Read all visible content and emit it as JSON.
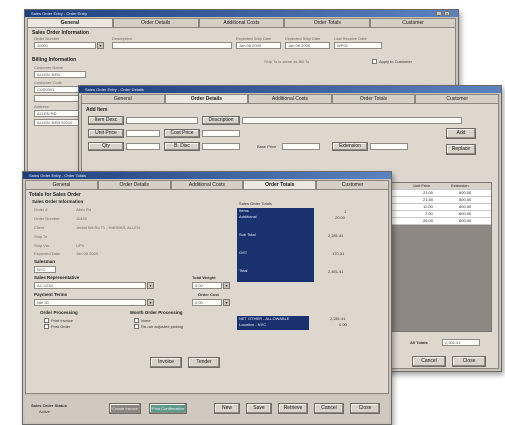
{
  "back_window": {
    "title": "Sales Order Entry - Order Entry",
    "tabs": [
      "General",
      "Order Details",
      "Additional Costs",
      "Order Totals",
      "Customer"
    ],
    "sales_header": "Sales Order Information",
    "field_labels": [
      "Order Number",
      "Description",
      "Expected Ship Date",
      "Expected Ship Date",
      "Last Receive Date"
    ],
    "field_values": [
      "10001",
      "",
      "Jan 08 2009",
      "Jan 08 2009",
      "WPGI"
    ],
    "billing_header": "Billing Information",
    "ship_to_same": "Ship To is same as Bill To",
    "apply_customer": "Apply to Customer",
    "left_labels": [
      "Customer Name",
      "Customer Code",
      "Address"
    ],
    "left_values": [
      "ALLEN, BEN",
      "CUS0001",
      "",
      "ALLEN RD",
      "ALLEN, BEN 92210"
    ]
  },
  "mid_window": {
    "title": "Sales Order Entry - Order Details",
    "tabs": [
      "General",
      "Order Details",
      "Additional Costs",
      "Order Totals",
      "Customer"
    ],
    "add_item_header": "Add Item",
    "labels": [
      "Item Desc",
      "Description",
      "Unit Price",
      "Cost Price",
      "Qty",
      "B. Disc",
      "Base Price",
      "Extension"
    ],
    "btn_add": "Add",
    "btn_replace": "Replace",
    "grid_headers": [
      "Unit Price",
      "Extension"
    ],
    "grid_rows": [
      [
        "21.00",
        "600.00"
      ],
      [
        "21.50",
        "600.00"
      ],
      [
        "11.00",
        "600.00"
      ],
      [
        "7.00",
        "600.00"
      ],
      [
        "26.00",
        "600.00"
      ]
    ],
    "all_totals_label": "All Totals",
    "all_totals_value": "2,301.41",
    "btn_cancel": "Cancel",
    "btn_close": "Close"
  },
  "front_window": {
    "title": "Sales Order Entry - Order Totals",
    "tabs": [
      "General",
      "Order Details",
      "Additional Costs",
      "Order Totals",
      "Customer"
    ],
    "section_title": "Totals for Sales Order",
    "subsection": "Sales Order Information",
    "info_rows": [
      {
        "label": "Order #",
        "value": "Allen Rd"
      },
      {
        "label": "Order Number",
        "value": "11449"
      },
      {
        "label": "Client",
        "value": "Jerald Bill Rd 71 - HARBAS, ALLEN"
      },
      {
        "label": "Ship To",
        "value": ""
      },
      {
        "label": "Ship Via",
        "value": "UPS"
      },
      {
        "label": "Expected Date",
        "value": "Jan 08 2009"
      }
    ],
    "salesman_label": "Salesman",
    "salesman_value": "NYC",
    "sales_rep_label": "Sales Representative",
    "sales_rep_value": "AC-1234",
    "total_weight_label": "Total Weight",
    "total_weight_value": "0.00",
    "payment_terms_label": "Payment Terms",
    "payment_terms_value": "Net 30",
    "order_cost_label": "Order Cost",
    "order_cost_value": "0.00",
    "order_processing_label": "Order Processing",
    "opt_print_invoice": "Print Invoice",
    "opt_post_order": "Post Order",
    "month_end_label": "Month Order Processing",
    "opt_none": "None",
    "opt_reprocess": "Re-run adjusted picking",
    "btn_invoice": "Invoice",
    "btn_tender": "Tender",
    "totals_header": "Sales Order Totals",
    "totals_rows": [
      {
        "label": "Items",
        "value": "1"
      },
      {
        "label": "Additional",
        "value": "20.00"
      },
      {
        "label": "Sub Total",
        "value": "2,281.41"
      },
      {
        "label": "GST",
        "value": "170.01"
      },
      {
        "label": "Total",
        "value": "2,451.41"
      }
    ],
    "balance_rows": [
      {
        "label": "NET OTHER - ALLOWABLE",
        "value": "2,281.41"
      },
      {
        "label": "Location - NYC",
        "value": "0.00"
      }
    ],
    "status_label": "Sales Order Status",
    "status_value": "Active",
    "btn_create_invoice": "Create Invoice",
    "btn_print_confirmation": "Print Confirmation",
    "btn_new": "New",
    "btn_save": "Save",
    "btn_retrieve": "Retrieve",
    "btn_cancel": "Cancel",
    "btn_close": "Close"
  }
}
